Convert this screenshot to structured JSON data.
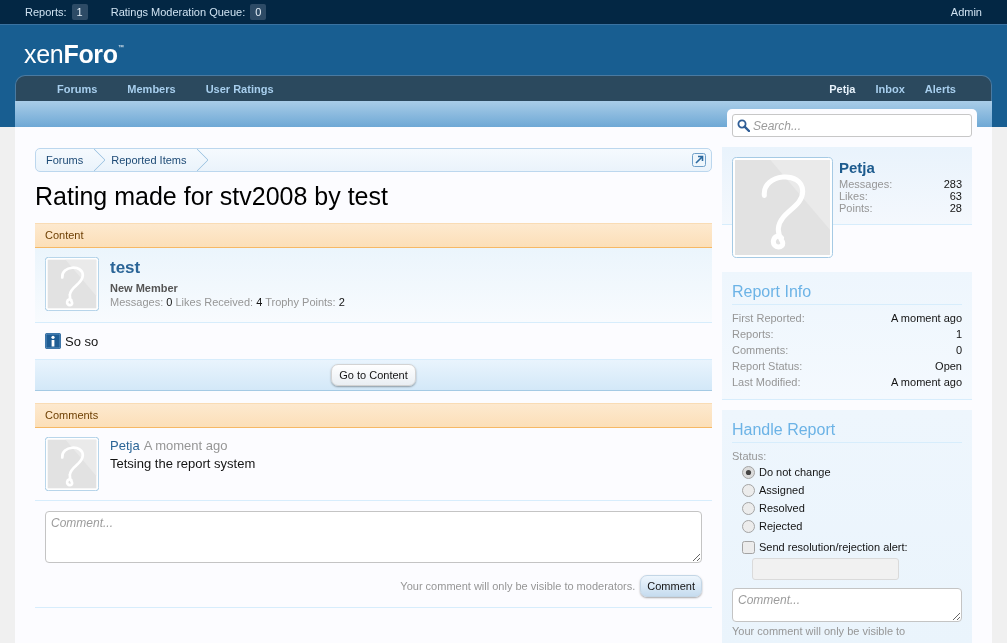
{
  "top_bar": {
    "items": [
      {
        "label": "Reports:",
        "count": "1"
      },
      {
        "label": "Ratings Moderation Queue:",
        "count": "0"
      }
    ],
    "account": "Admin"
  },
  "header": {
    "logo": "xen**Foro**$^{™}$"
  },
  "nav": {
    "tabs": [
      {
        "label": "Forums"
      },
      {
        "label": "Members"
      },
      {
        "label": "User Ratings"
      }
    ],
    "user_links": [
      {
        "label": "Petja",
        "kind": "username"
      },
      {
        "label": "Inbox",
        "kind": "link"
      },
      {
        "label": "Alerts",
        "kind": "link"
      }
    ]
  },
  "search": {
    "placeholder": "Search..."
  },
  "breadcrumb": {
    "items": [
      "Forums",
      "Reported Items"
    ]
  },
  "title": "Rating made for stv2008 by test",
  "content_section": {
    "heading": "Content",
    "author": {
      "name": "test",
      "user_title": "New Member",
      "stats": [
        {
          "label": "Messages:",
          "value": "0"
        },
        {
          "label": "Likes Received:",
          "value": "4"
        },
        {
          "label": "Trophy Points:",
          "value": "2"
        }
      ]
    },
    "message": "So so",
    "button": "Go to Content"
  },
  "comments_section": {
    "heading": "Comments",
    "comments": [
      {
        "author": "Petja",
        "time": "A moment ago",
        "text": "Tetsing the report system"
      }
    ],
    "comment_box": {
      "placeholder": "Comment..."
    },
    "note": "Your comment will only be visible to moderators.",
    "button": "Comment"
  },
  "sidebar": {
    "visitor": {
      "name": "Petja",
      "stats": [
        {
          "label": "Messages:",
          "value": "283"
        },
        {
          "label": "Likes:",
          "value": "63"
        },
        {
          "label": "Points:",
          "value": "28"
        }
      ]
    },
    "report_info": {
      "heading": "Report Info",
      "rows": [
        {
          "label": "First Reported:",
          "value": "A moment ago"
        },
        {
          "label": "Reports:",
          "value": "1"
        },
        {
          "label": "Comments:",
          "value": "0"
        },
        {
          "label": "Report Status:",
          "value": "Open"
        },
        {
          "label": "Last Modified:",
          "value": "A moment ago"
        }
      ]
    },
    "handle_report": {
      "heading": "Handle Report",
      "status_label": "Status:",
      "options": [
        {
          "label": "Do not change",
          "selected": true
        },
        {
          "label": "Assigned",
          "selected": false
        },
        {
          "label": "Resolved",
          "selected": false
        },
        {
          "label": "Rejected",
          "selected": false
        }
      ],
      "alert": {
        "label": "Send resolution/rejection alert:",
        "checked": false,
        "message_field": {
          "disabled": true
        }
      },
      "comment_box": {
        "placeholder": "Comment..."
      },
      "note": "Your comment will only be visible to"
    }
  }
}
